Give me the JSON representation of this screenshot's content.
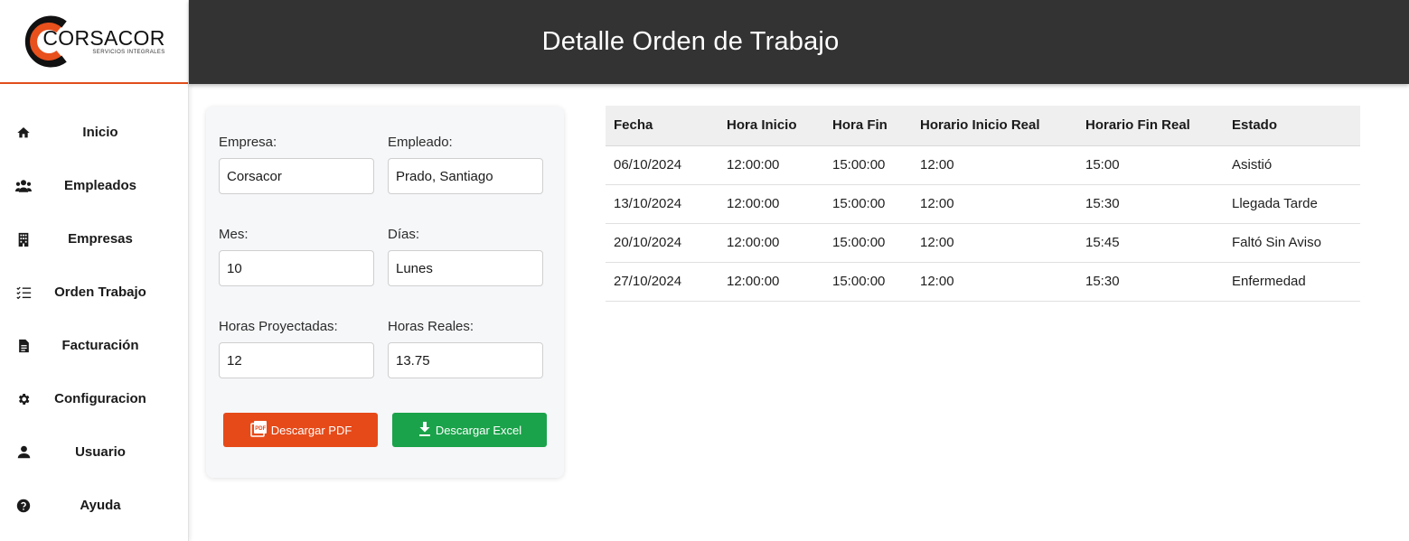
{
  "brand": {
    "name": "CORSACOR",
    "tagline": "SERVICIOS INTEGRALES",
    "colors": {
      "accent": "#e04e1b",
      "header_bg": "#333333",
      "pdf": "#e64a19",
      "excel": "#1aa34a"
    }
  },
  "header": {
    "title": "Detalle Orden de Trabajo"
  },
  "sidebar": {
    "items": [
      {
        "label": "Inicio",
        "icon": "home-icon"
      },
      {
        "label": "Empleados",
        "icon": "people-icon"
      },
      {
        "label": "Empresas",
        "icon": "building-icon"
      },
      {
        "label": "Orden Trabajo",
        "icon": "checklist-icon"
      },
      {
        "label": "Facturación",
        "icon": "document-icon"
      },
      {
        "label": "Configuracion",
        "icon": "gear-icon"
      },
      {
        "label": "Usuario",
        "icon": "user-icon"
      },
      {
        "label": "Ayuda",
        "icon": "help-icon"
      }
    ]
  },
  "form": {
    "empresa": {
      "label": "Empresa:",
      "value": "Corsacor"
    },
    "empleado": {
      "label": "Empleado:",
      "value": "Prado, Santiago"
    },
    "mes": {
      "label": "Mes:",
      "value": "10"
    },
    "dias": {
      "label": "Días:",
      "value": "Lunes"
    },
    "horas_proyectadas": {
      "label": "Horas Proyectadas:",
      "value": "12"
    },
    "horas_reales": {
      "label": "Horas Reales:",
      "value": "13.75"
    },
    "pdf_button": "Descargar PDF",
    "excel_button": "Descargar Excel"
  },
  "table": {
    "headers": [
      "Fecha",
      "Hora Inicio",
      "Hora Fin",
      "Horario Inicio Real",
      "Horario Fin Real",
      "Estado"
    ],
    "rows": [
      [
        "06/10/2024",
        "12:00:00",
        "15:00:00",
        "12:00",
        "15:00",
        "Asistió"
      ],
      [
        "13/10/2024",
        "12:00:00",
        "15:00:00",
        "12:00",
        "15:30",
        "Llegada Tarde"
      ],
      [
        "20/10/2024",
        "12:00:00",
        "15:00:00",
        "12:00",
        "15:45",
        "Faltó Sin Aviso"
      ],
      [
        "27/10/2024",
        "12:00:00",
        "15:00:00",
        "12:00",
        "15:30",
        "Enfermedad"
      ]
    ]
  }
}
